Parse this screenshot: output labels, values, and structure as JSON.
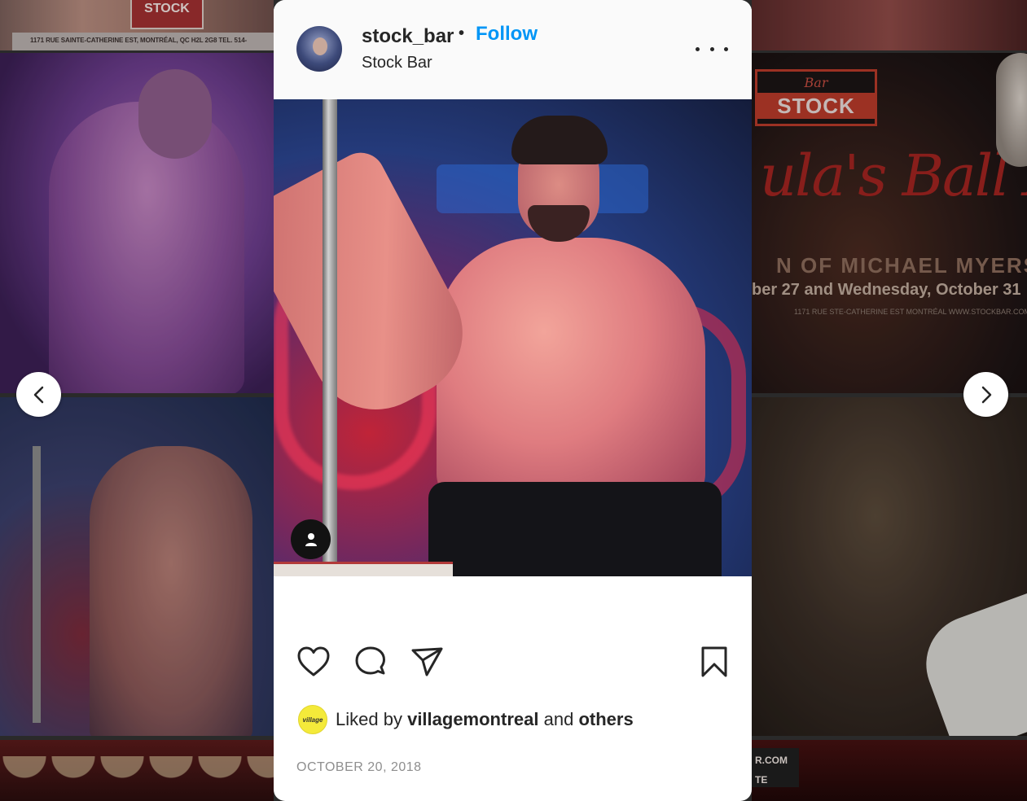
{
  "background": {
    "top_left_address": "1171 RUE SAINTE-CATHERINE EST, MONTRÉAL, QC H2L 2G8 TEL. 514-",
    "top_left_logo": "STOCK",
    "poster": {
      "bar": "Bar",
      "stock": "STOCK",
      "ball_text": "ula's Ball X",
      "myers_text": "N OF MICHAEL MYERS",
      "date_text": "ber 27 and Wednesday, October 31",
      "address_text": "1171 RUE STE-CATHERINE EST MONTRÉAL  WWW.STOCKBAR.COM"
    },
    "bottom_right_box": [
      "R.COM",
      "TE"
    ]
  },
  "post": {
    "username": "stock_bar",
    "separator": "•",
    "follow_label": "Follow",
    "location": "Stock Bar",
    "liked_by_prefix": "Liked by",
    "liked_by_user": "villagemontreal",
    "liked_by_connector": "and",
    "liked_by_others": "others",
    "liker_avatar_text": "village",
    "date": "OCTOBER 20, 2018"
  },
  "icons": {
    "prev": "chevron-left-icon",
    "next": "chevron-right-icon",
    "more": "more-options-icon",
    "tag": "user-tag-icon",
    "like": "heart-icon",
    "comment": "comment-icon",
    "share": "paper-plane-icon",
    "save": "bookmark-icon"
  },
  "colors": {
    "follow_blue": "#0095f6",
    "text": "#262626",
    "muted": "#8e8e8e",
    "liker_yellow": "#f4ea3a"
  }
}
